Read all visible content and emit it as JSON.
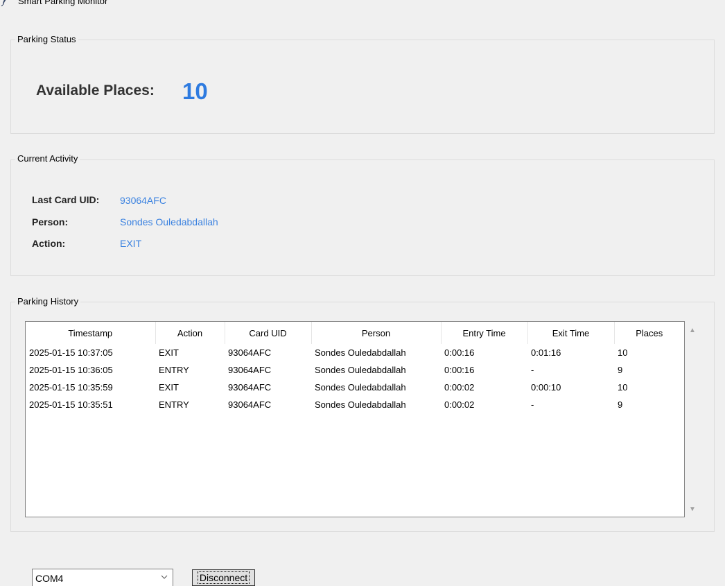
{
  "window": {
    "title": "Smart Parking Monitor",
    "icon": "feather-icon"
  },
  "status": {
    "legend": "Parking Status",
    "available_label": "Available Places:",
    "available_value": "10",
    "value_color": "#2e7be0"
  },
  "activity": {
    "legend": "Current Activity",
    "card_label": "Last Card UID:",
    "card_value": "93064AFC",
    "person_label": "Person:",
    "person_value": "Sondes Ouledabdallah",
    "action_label": "Action:",
    "action_value": "EXIT"
  },
  "history": {
    "legend": "Parking History",
    "columns": [
      "Timestamp",
      "Action",
      "Card UID",
      "Person",
      "Entry Time",
      "Exit Time",
      "Places"
    ],
    "rows": [
      [
        "2025-01-15 10:37:05",
        "EXIT",
        "93064AFC",
        "Sondes Ouledabdallah",
        "0:00:16",
        "0:01:16",
        "10"
      ],
      [
        "2025-01-15 10:36:05",
        "ENTRY",
        "93064AFC",
        "Sondes Ouledabdallah",
        "0:00:16",
        "-",
        "9"
      ],
      [
        "2025-01-15 10:35:59",
        "EXIT",
        "93064AFC",
        "Sondes Ouledabdallah",
        "0:00:02",
        "0:00:10",
        "10"
      ],
      [
        "2025-01-15 10:35:51",
        "ENTRY",
        "93064AFC",
        "Sondes Ouledabdallah",
        "0:00:02",
        "-",
        "9"
      ]
    ]
  },
  "controls": {
    "port_value": "COM4",
    "disconnect_label": "Disconnect"
  }
}
